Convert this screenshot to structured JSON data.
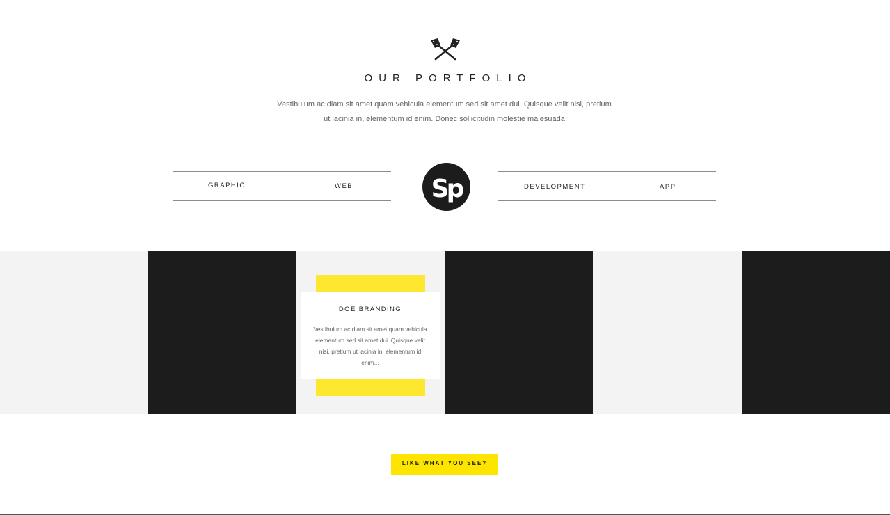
{
  "header": {
    "emblem_icon": "crossed-axes-icon",
    "title": "OUR PORTFOLIO",
    "description_line1": "Vestibulum ac diam sit amet quam vehicula elementum sed sit amet dui. Quisque velit nisi, pretium",
    "description_line2": "ut lacinia in, elementum id enim. Donec sollicitudin molestie malesuada"
  },
  "filters": {
    "left": [
      "GRAPHIC",
      "WEB"
    ],
    "right": [
      "DEVELOPMENT",
      "APP"
    ],
    "logo_text": "Sp"
  },
  "portfolio": {
    "card_title": "DOE BRANDING",
    "card_text": "Vestibulum ac diam sit amet quam vehicula elementum sed sit amet dui. Quisque velit nisi, pretium ut lacinia in, elementum id enim..."
  },
  "cta": {
    "label": "LIKE WHAT YOU SEE?"
  },
  "colors": {
    "accent_yellow": "#fde500",
    "tile_dark": "#1c1c1c",
    "tile_light": "#f3f3f3"
  }
}
